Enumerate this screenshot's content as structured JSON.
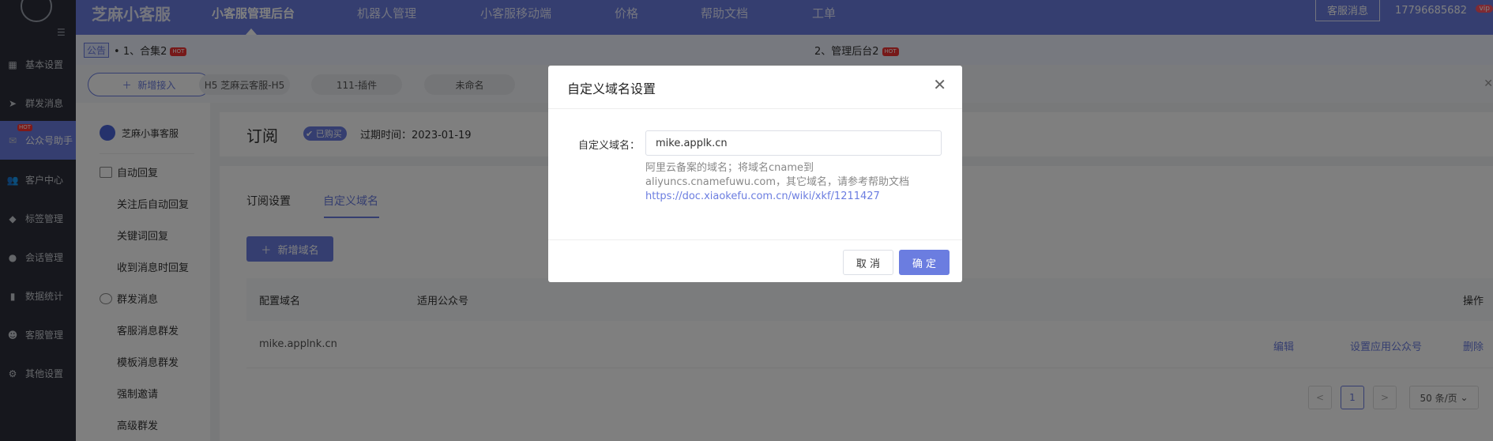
{
  "brand": "芝麻小客服",
  "topnav": [
    {
      "label": "小客服管理后台"
    },
    {
      "label": "机器人管理"
    },
    {
      "label": "小客服移动端"
    },
    {
      "label": "价格"
    },
    {
      "label": "帮助文档"
    },
    {
      "label": "工单"
    }
  ],
  "header": {
    "kf_msg": "客服消息",
    "phone": "17796685682",
    "vip": "vip"
  },
  "rail": [
    {
      "label": "基本设置"
    },
    {
      "label": "群发消息"
    },
    {
      "label": "公众号助手",
      "badge": "HOT"
    },
    {
      "label": "客户中心"
    },
    {
      "label": "标签管理"
    },
    {
      "label": "会话管理"
    },
    {
      "label": "数据统计"
    },
    {
      "label": "客服管理"
    },
    {
      "label": "其他设置"
    }
  ],
  "notice": {
    "tag": "公告",
    "item1": "1、合集2",
    "item2": "2、管理后台2",
    "hot": "HOT"
  },
  "channels": {
    "add": "新增接入",
    "items": [
      "H5 芝麻云客服-H5",
      "111-插件",
      "未命名"
    ]
  },
  "subside": {
    "head": "芝麻小事客服",
    "groups": [
      {
        "label": "自动回复",
        "items": [
          "关注后自动回复",
          "关键词回复",
          "收到消息时回复"
        ]
      },
      {
        "label": "群发消息",
        "items": [
          "客服消息群发",
          "模板消息群发",
          "强制邀请",
          "高级群发"
        ]
      }
    ]
  },
  "page": {
    "title": "订阅",
    "bought": "已购买",
    "expire": "过期时间：2023-01-19"
  },
  "tabs": [
    "订阅设置",
    "自定义域名"
  ],
  "new_domain": "新增域名",
  "table": {
    "headers": [
      "配置域名",
      "适用公众号",
      "操作"
    ],
    "rows": [
      {
        "domain": "mike.applnk.cn",
        "actions": [
          "编辑",
          "设置应用公众号",
          "删除"
        ]
      }
    ]
  },
  "pager": {
    "prev": "<",
    "current": "1",
    "next": ">",
    "size": "50 条/页"
  },
  "modal": {
    "title": "自定义域名设置",
    "label": "自定义域名：",
    "value": "mike.applk.cn",
    "help1": "阿里云备案的域名；将域名cname到",
    "help2": "aliyuncs.cnamefuwu.com，其它域名，请参考帮助文档",
    "help_link": "https://doc.xiaokefu.com.cn/wiki/xkf/1211427",
    "cancel": "取 消",
    "ok": "确 定"
  }
}
